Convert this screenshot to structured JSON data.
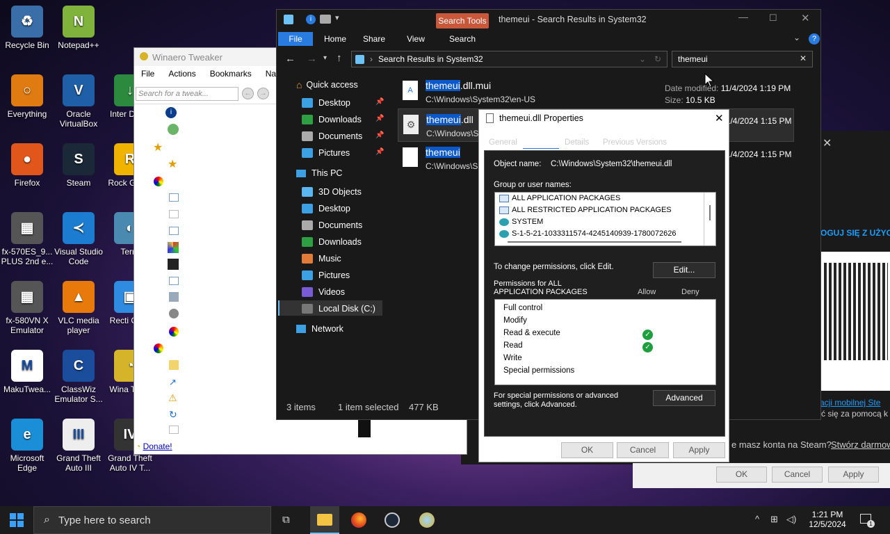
{
  "desktop": {
    "icons": [
      {
        "label": "Recycle Bin",
        "color": "#3a6ea8",
        "glyph": "♻"
      },
      {
        "label": "Notepad++",
        "color": "#7fb33c",
        "glyph": "N"
      },
      {
        "label": "Everything",
        "color": "#e07b12",
        "glyph": "○"
      },
      {
        "label": "Oracle VirtualBox",
        "color": "#1f5fa8",
        "glyph": "V"
      },
      {
        "label": "Inter Down",
        "color": "#2b8a3e",
        "glyph": "↓"
      },
      {
        "label": "Firefox",
        "color": "#e0561b",
        "glyph": "●"
      },
      {
        "label": "Steam",
        "color": "#1b2838",
        "glyph": "S"
      },
      {
        "label": "Rock Game",
        "color": "#f0b400",
        "glyph": "R"
      },
      {
        "label": "fx-570ES_9... PLUS 2nd e...",
        "color": "#555",
        "glyph": "▦"
      },
      {
        "label": "Visual Studio Code",
        "color": "#1c7dd0",
        "glyph": "≺"
      },
      {
        "label": "Terra",
        "color": "#4a8ab0",
        "glyph": "◐"
      },
      {
        "label": "fx-580VN X Emulator",
        "color": "#555",
        "glyph": "▦"
      },
      {
        "label": "VLC media player",
        "color": "#e87a0c",
        "glyph": "▲"
      },
      {
        "label": "Recti Conti",
        "color": "#2e8be0",
        "glyph": "▣"
      },
      {
        "label": "MakuTwea...",
        "color": "#ffffff",
        "glyph": "M"
      },
      {
        "label": "ClassWiz Emulator S...",
        "color": "#1a4e9c",
        "glyph": "C"
      },
      {
        "label": "Wina Twea",
        "color": "#d6b42a",
        "glyph": "◔"
      },
      {
        "label": "Microsoft Edge",
        "color": "#1a8fd8",
        "glyph": "e"
      },
      {
        "label": "Grand Theft Auto III",
        "color": "#eeeeee",
        "glyph": "III"
      },
      {
        "label": "Grand Theft Auto IV T...",
        "color": "#333",
        "glyph": "IV"
      }
    ]
  },
  "winaero": {
    "title": "Winaero Tweaker",
    "menu": [
      "File",
      "Actions",
      "Bookmarks",
      "Navi"
    ],
    "search_placeholder": "Search for a tweak...",
    "donate": "Donate!"
  },
  "explorer": {
    "title": "themeui - Search Results in System32",
    "search_tools_tab": "Search Tools",
    "ribbon_tabs": [
      "File",
      "Home",
      "Share",
      "View",
      "Search"
    ],
    "address": "Search Results in System32",
    "search_value": "themeui",
    "nav": {
      "quick_access": "Quick access",
      "qa_items": [
        "Desktop",
        "Downloads",
        "Documents",
        "Pictures"
      ],
      "this_pc": "This PC",
      "pc_items": [
        "3D Objects",
        "Desktop",
        "Documents",
        "Downloads",
        "Music",
        "Pictures",
        "Videos",
        "Local Disk (C:)"
      ],
      "network": "Network"
    },
    "results": [
      {
        "hl": "themeui",
        "rest": ".dll.mui",
        "path": "C:\\Windows\\System32\\en-US",
        "date_label": "Date modified:",
        "date": "11/4/2024 1:19 PM",
        "size_label": "Size:",
        "size": "10.5 KB"
      },
      {
        "hl": "themeui",
        "rest": ".dll",
        "path": "C:\\Windows\\S",
        "date": "11/4/2024 1:15 PM"
      },
      {
        "hl": "themeui",
        "rest": "",
        "path": "C:\\Windows\\S",
        "date": "11/4/2024 1:15 PM"
      }
    ],
    "status": {
      "count": "3 items",
      "selected": "1 item selected",
      "size": "477 KB"
    }
  },
  "props": {
    "title": "themeui.dll Properties",
    "tabs": [
      "General",
      "",
      "Details",
      "Previous Versions"
    ],
    "object_label": "Object name:",
    "object_value": "C:\\Windows\\System32\\themeui.dll",
    "group_label": "Group or user names:",
    "users": [
      "ALL APPLICATION PACKAGES",
      "ALL RESTRICTED APPLICATION PACKAGES",
      "SYSTEM",
      "S-1-5-21-1033311574-4245140939-1780072626"
    ],
    "change_text": "To change permissions, click Edit.",
    "edit": "Edit...",
    "perm_for": "Permissions for ALL APPLICATION PACKAGES",
    "allow": "Allow",
    "deny": "Deny",
    "perms": [
      "Full control",
      "Modify",
      "Read & execute",
      "Read",
      "Write",
      "Special permissions"
    ],
    "advanced_text": "For special permissions or advanced settings, click Advanced.",
    "advanced": "Advanced",
    "ok": "OK",
    "cancel": "Cancel",
    "apply": "Apply"
  },
  "steam": {
    "login_text": "OGUJ SIĘ Z UŻYC",
    "link1": "kacji mobilnej Ste",
    "text2": "ć się za pomocą k",
    "no_account": "e masz konta na Steam?",
    "create": "Stwórz darmow",
    "ok": "OK",
    "cancel": "Cancel",
    "apply": "Apply"
  },
  "taskbar": {
    "search_placeholder": "Type here to search",
    "time": "1:21 PM",
    "date": "12/5/2024",
    "notif_count": "1"
  }
}
